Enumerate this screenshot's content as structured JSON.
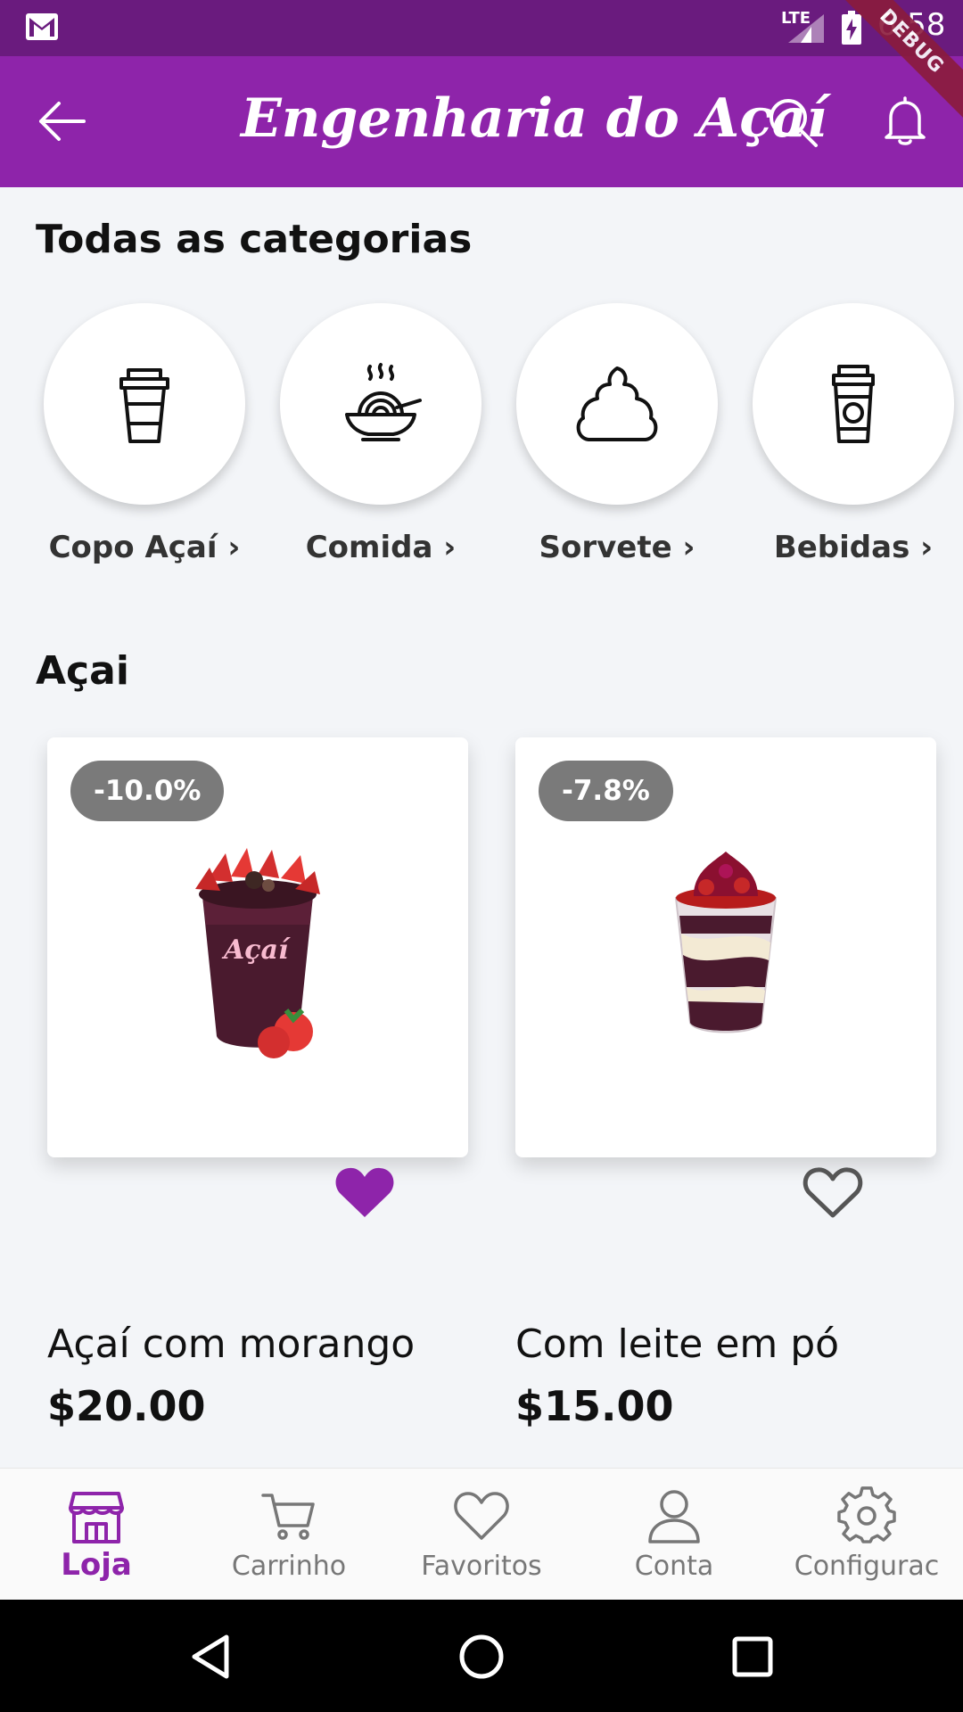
{
  "status_bar": {
    "network": "LTE",
    "time": "6:58",
    "debug_label": "DEBUG"
  },
  "app_bar": {
    "title": "Engenharia do Açaí"
  },
  "categories_section": {
    "title": "Todas as categorias",
    "items": [
      {
        "label": "Copo Açaí ›",
        "icon": "cup-icon"
      },
      {
        "label": "Comida ›",
        "icon": "bowl-icon"
      },
      {
        "label": "Sorvete ›",
        "icon": "ice-cream-icon"
      },
      {
        "label": "Bebidas ›",
        "icon": "drink-icon"
      }
    ]
  },
  "products_section": {
    "title": "Açai",
    "products": [
      {
        "discount": "-10.0%",
        "name": "Açaí com morango",
        "price": "$20.00",
        "favorited": true
      },
      {
        "discount": "-7.8%",
        "name": "Com leite em pó",
        "price": "$15.00",
        "favorited": false
      }
    ]
  },
  "bottom_nav": {
    "items": [
      {
        "label": "Loja",
        "icon": "store-icon",
        "active": true
      },
      {
        "label": "Carrinho",
        "icon": "cart-icon",
        "active": false
      },
      {
        "label": "Favoritos",
        "icon": "heart-icon",
        "active": false
      },
      {
        "label": "Conta",
        "icon": "account-icon",
        "active": false
      },
      {
        "label": "Configurac",
        "icon": "gear-icon",
        "active": false
      }
    ]
  },
  "colors": {
    "primary": "#8e24aa",
    "status_bar": "#6a1b7e",
    "badge": "#7a7a7a",
    "background": "#f3f5f8"
  }
}
